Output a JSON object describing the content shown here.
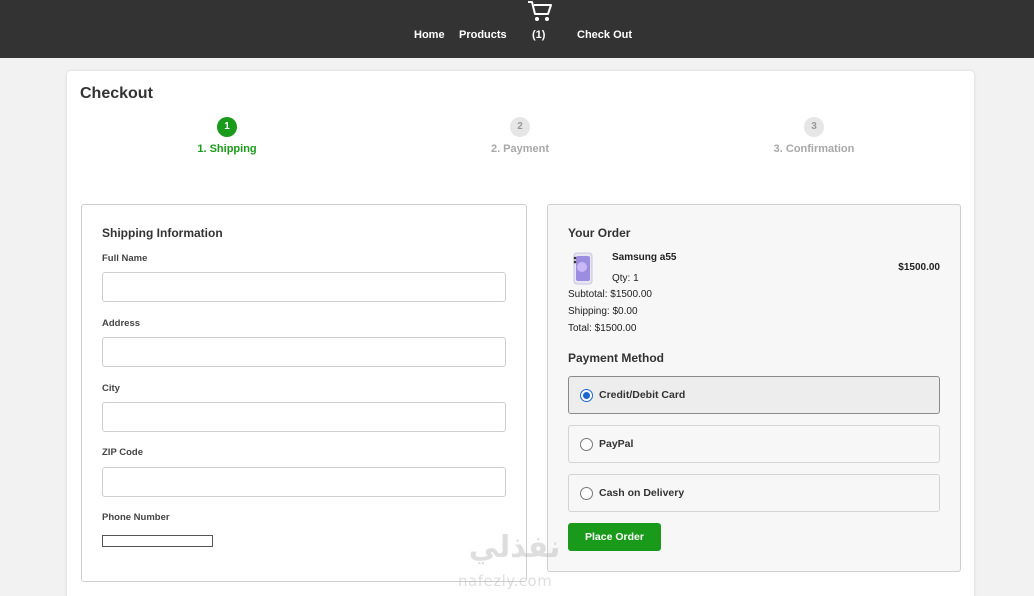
{
  "nav": {
    "links": [
      "Home",
      "Products",
      "(1)",
      "Check Out"
    ],
    "cart_icon": "cart-icon"
  },
  "checkout": {
    "title": "Checkout",
    "steps": [
      {
        "number": "1",
        "label": "1. Shipping",
        "active": true
      },
      {
        "number": "2",
        "label": "2. Payment",
        "active": false
      },
      {
        "number": "3",
        "label": "3. Confirmation",
        "active": false
      }
    ]
  },
  "shipping": {
    "title": "Shipping Information",
    "fields": [
      {
        "label": "Full Name",
        "value": ""
      },
      {
        "label": "Address",
        "value": ""
      },
      {
        "label": "City",
        "value": ""
      },
      {
        "label": "ZIP Code",
        "value": ""
      },
      {
        "label": "Phone Number",
        "value": ""
      }
    ]
  },
  "order": {
    "title": "Your Order",
    "item": {
      "name": "Samsung a55",
      "qty": "Qty: 1",
      "price": "$1500.00"
    },
    "subtotal": "Subtotal: $1500.00",
    "shipping": "Shipping: $0.00",
    "total": "Total: $1500.00"
  },
  "payment": {
    "title": "Payment Method",
    "options": [
      {
        "label": "Credit/Debit Card",
        "selected": true
      },
      {
        "label": "PayPal",
        "selected": false
      },
      {
        "label": "Cash on Delivery",
        "selected": false
      }
    ],
    "submit_label": "Place Order"
  },
  "watermark": {
    "arabic": "نفذلي",
    "latin": "nafezly.com"
  },
  "colors": {
    "accent": "#1a9a1a",
    "topbar": "#333333",
    "radio": "#1a66d2"
  }
}
